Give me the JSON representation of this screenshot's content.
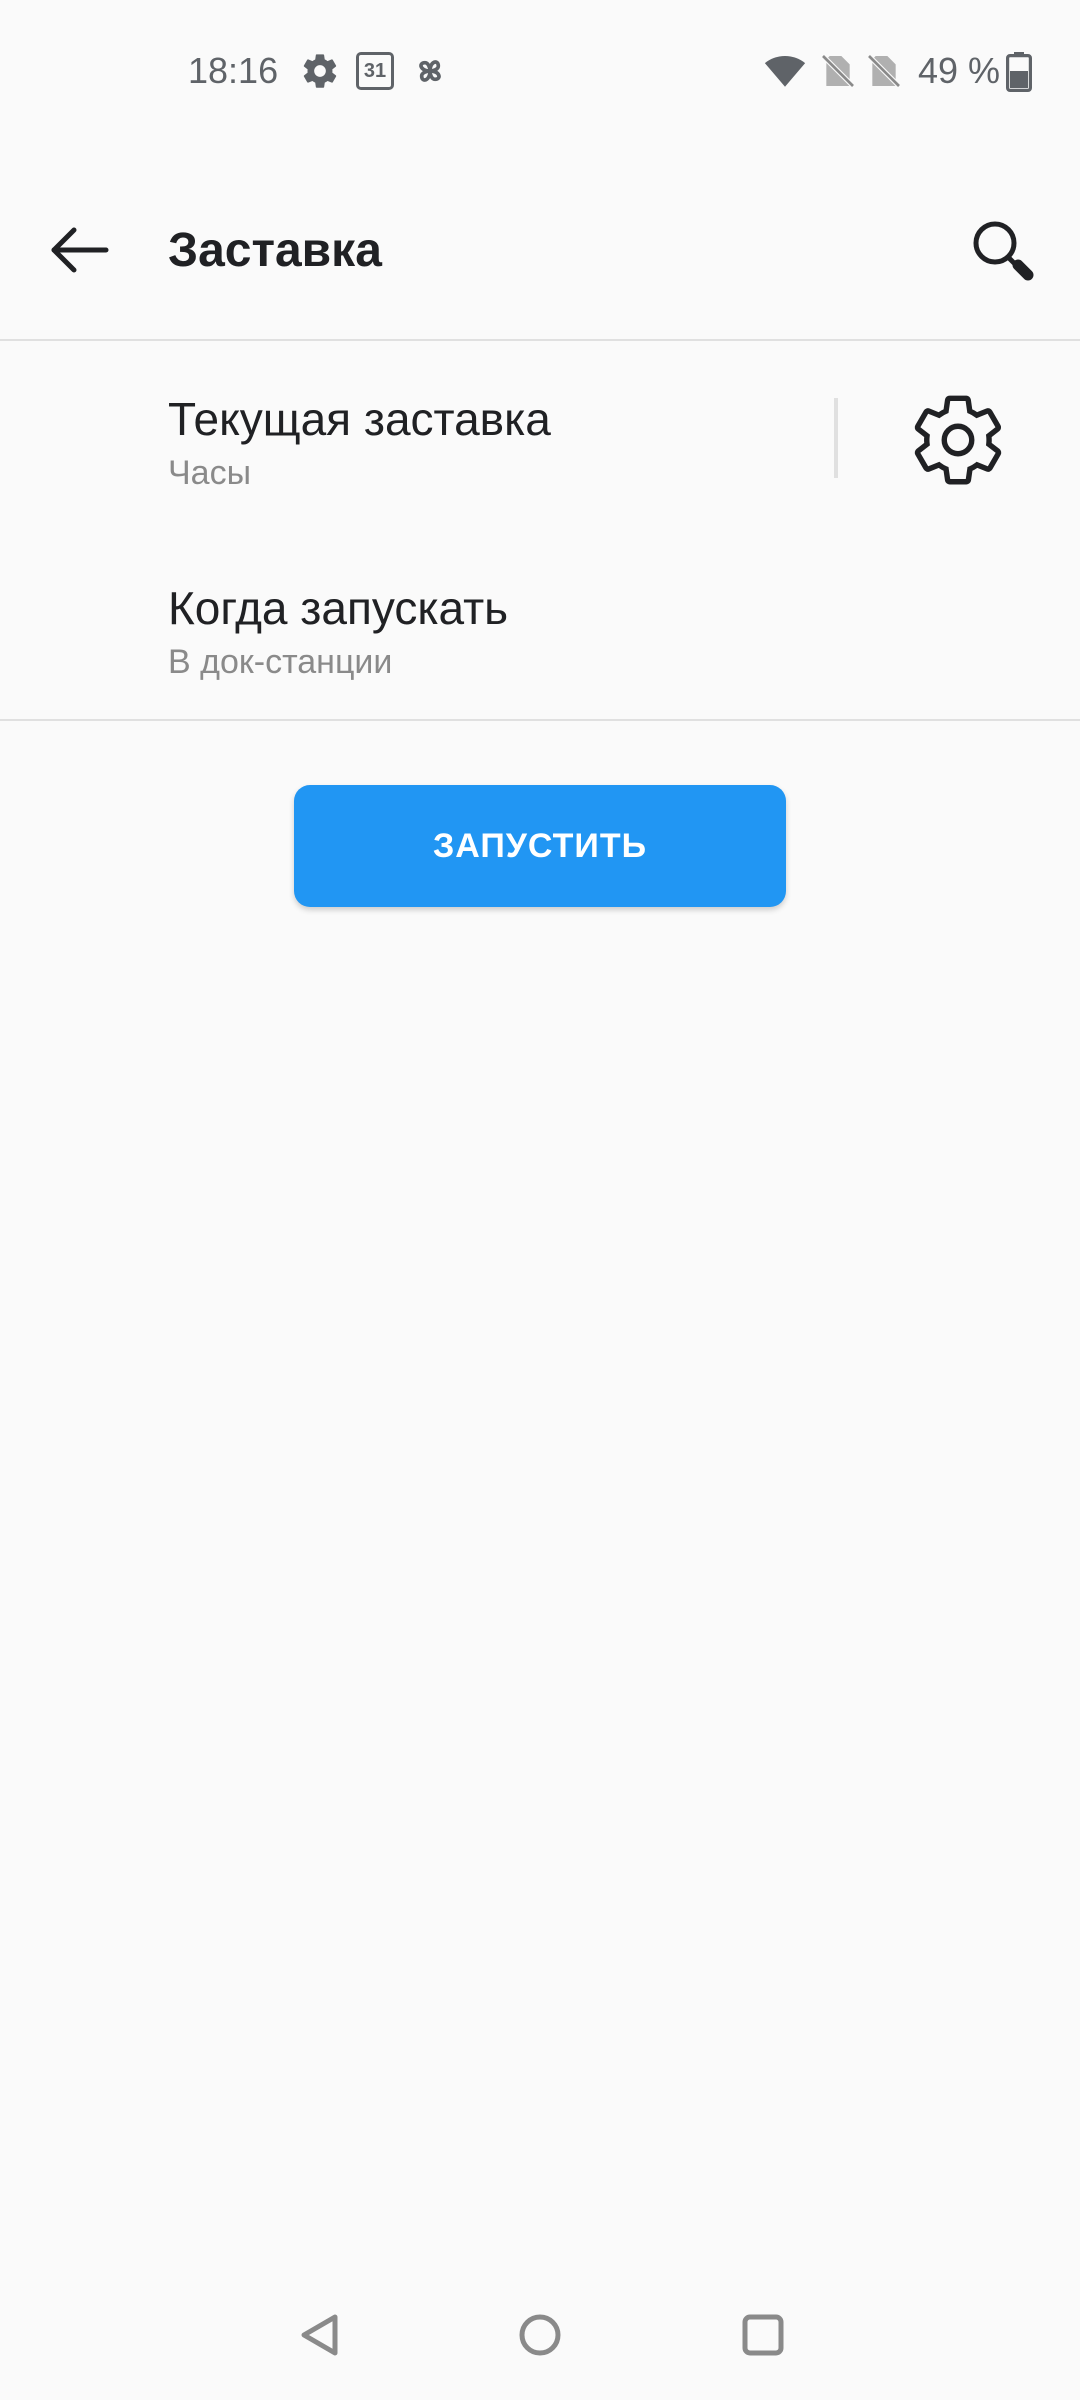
{
  "status_bar": {
    "time": "18:16",
    "calendar_day": "31",
    "battery": "49 %",
    "icons": [
      "gear-icon",
      "calendar-icon",
      "pinwheel-icon",
      "wifi-icon",
      "no-sim-icon",
      "no-sim-icon",
      "battery-icon"
    ]
  },
  "app_bar": {
    "title": "Заставка",
    "back_icon": "arrow-left-icon",
    "search_icon": "search-icon"
  },
  "preferences": [
    {
      "title": "Текущая заставка",
      "summary": "Часы",
      "action_icon": "gear-icon"
    },
    {
      "title": "Когда запускать",
      "summary": "В док-станции"
    }
  ],
  "start_button": {
    "label": "ЗАПУСТИТЬ"
  },
  "colors": {
    "accent": "#2196f3",
    "background": "#fafafa",
    "text_primary": "#202124",
    "text_secondary": "#8a8a8a"
  },
  "nav_bar": {
    "icons": [
      "back-triangle-icon",
      "home-circle-icon",
      "recents-square-icon"
    ]
  }
}
